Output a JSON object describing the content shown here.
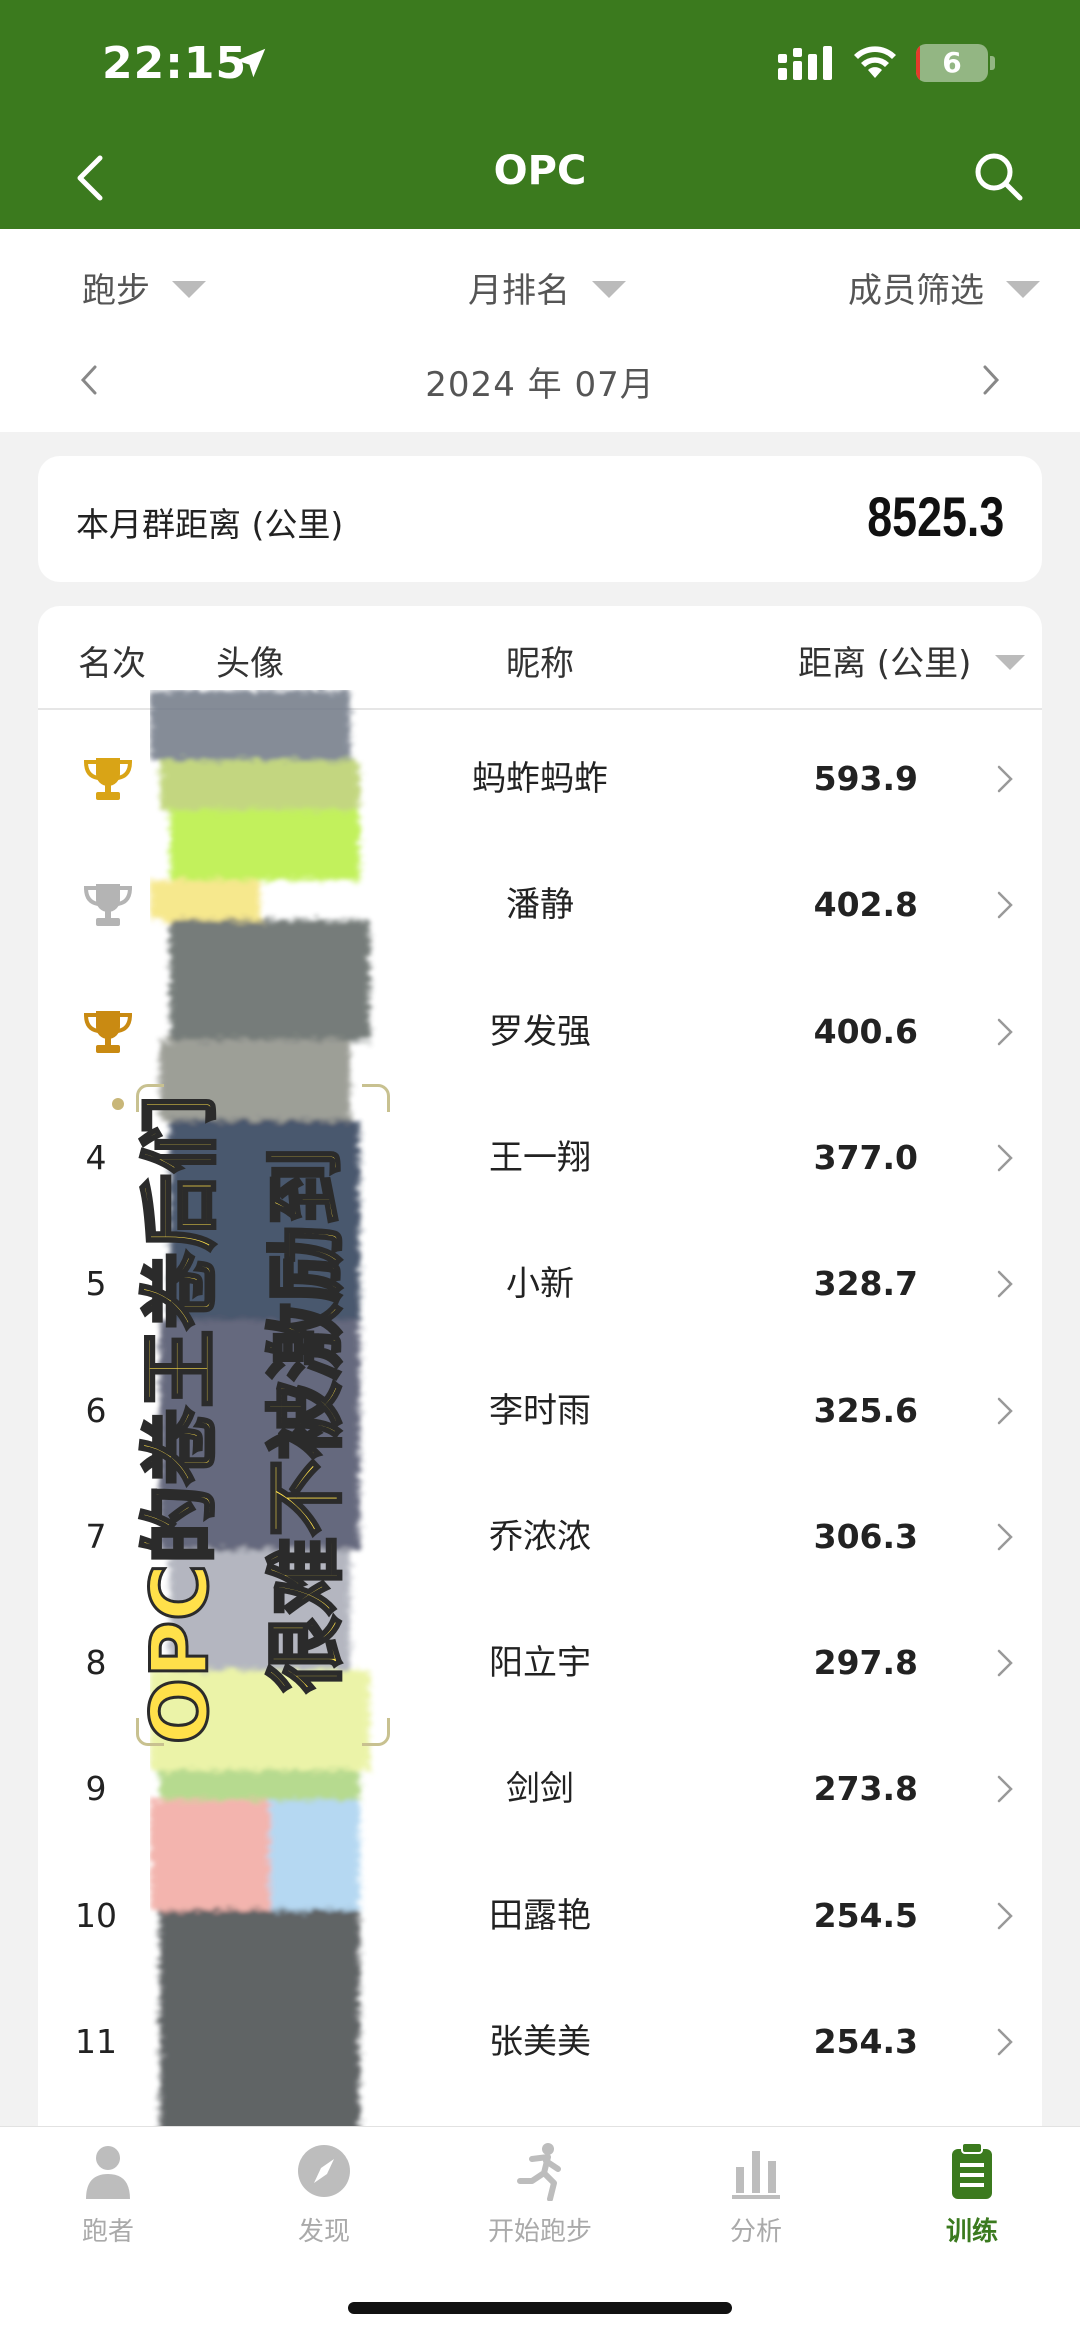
{
  "status_bar": {
    "time": "22:15",
    "battery_level": "6",
    "battery_fraction": 0.06
  },
  "nav": {
    "title": "OPC",
    "back_icon": "chevron-left-icon",
    "search_icon": "search-icon"
  },
  "filters": [
    {
      "label": "跑步"
    },
    {
      "label": "月排名"
    },
    {
      "label": "成员筛选"
    }
  ],
  "month": {
    "label": "2024 年 07月"
  },
  "summary": {
    "label": "本月群距离 (公里)",
    "value": "8525.3"
  },
  "table": {
    "headers": {
      "rank": "名次",
      "avatar": "头像",
      "name": "昵称",
      "distance": "距离 (公里)"
    },
    "rows": [
      {
        "rank": "1",
        "trophy": "gold",
        "name": "蚂蚱蚂蚱",
        "distance": "593.9"
      },
      {
        "rank": "2",
        "trophy": "silver",
        "name": "潘静",
        "distance": "402.8"
      },
      {
        "rank": "3",
        "trophy": "bronze",
        "name": "罗发强",
        "distance": "400.6"
      },
      {
        "rank": "4",
        "name": "王一翔",
        "distance": "377.0"
      },
      {
        "rank": "5",
        "name": "小新",
        "distance": "328.7"
      },
      {
        "rank": "6",
        "name": "李时雨",
        "distance": "325.6"
      },
      {
        "rank": "7",
        "name": "乔浓浓",
        "distance": "306.3"
      },
      {
        "rank": "8",
        "name": "阳立宇",
        "distance": "297.8"
      },
      {
        "rank": "9",
        "name": "剑剑",
        "distance": "273.8"
      },
      {
        "rank": "10",
        "name": "田露艳",
        "distance": "254.5"
      },
      {
        "rank": "11",
        "name": "张美美",
        "distance": "254.3"
      }
    ]
  },
  "overlay": {
    "line1": "OPC的卷王卷后们",
    "line2": "很难不被激励到"
  },
  "tabs": [
    {
      "label": "跑者",
      "icon": "person-icon",
      "active": false
    },
    {
      "label": "发现",
      "icon": "compass-icon",
      "active": false
    },
    {
      "label": "开始跑步",
      "icon": "runner-icon",
      "active": false
    },
    {
      "label": "分析",
      "icon": "bar-chart-icon",
      "active": false
    },
    {
      "label": "训练",
      "icon": "clipboard-icon",
      "active": true
    }
  ],
  "colors": {
    "brand_green": "#3b7a1e",
    "gold": "#d9a416",
    "silver": "#b4b4b4",
    "bronze": "#c98a12",
    "overlay_text": "#ffe04a"
  }
}
